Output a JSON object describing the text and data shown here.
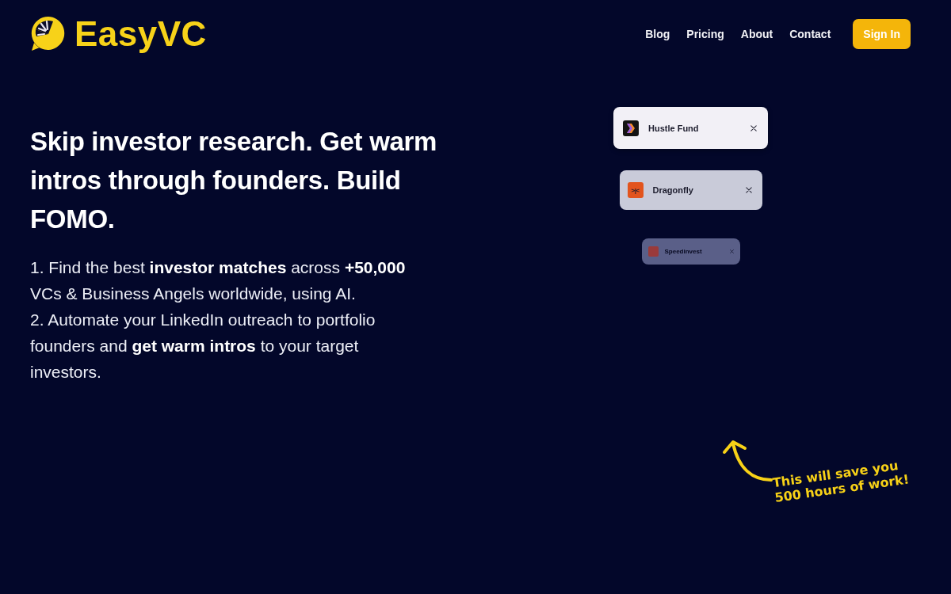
{
  "header": {
    "logo": {
      "text": "EasyVC"
    },
    "nav": [
      {
        "label": "Blog"
      },
      {
        "label": "Pricing"
      },
      {
        "label": "About"
      },
      {
        "label": "Contact"
      }
    ],
    "sign_in": "Sign In"
  },
  "hero": {
    "heading": "Skip investor research. Get warm intros through founders. Build FOMO.",
    "points": [
      "1. Find the best **investor matches** across **+50,000** VCs & Business Angels worldwide, using AI.",
      "2. Automate your LinkedIn outreach to portfolio founders and **get warm intros** to your target investors."
    ]
  },
  "investor_cards": [
    {
      "name": "Hustle Fund",
      "logo": {
        "kind": "chevrons"
      }
    },
    {
      "name": "Dragonfly",
      "logo": {
        "kind": "monogram",
        "text": ">|<"
      }
    },
    {
      "name": "Speedinvest",
      "logo": {
        "kind": "tile"
      }
    }
  ],
  "annotation": {
    "lines": [
      "This will save you",
      "500 hours of work!"
    ]
  }
}
